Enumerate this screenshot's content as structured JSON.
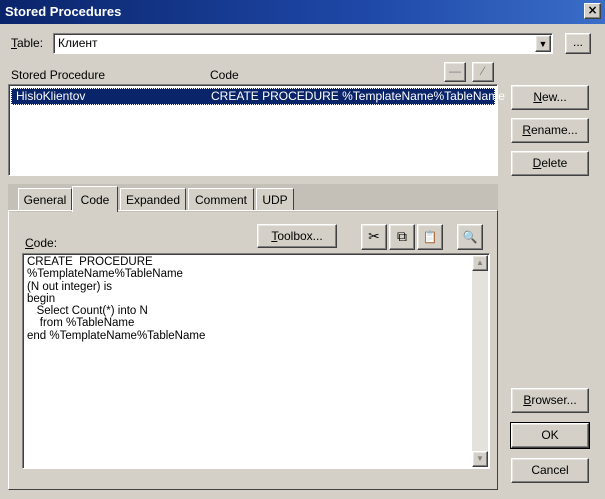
{
  "window": {
    "title": "Stored Procedures",
    "close_glyph": "×"
  },
  "table": {
    "label_hot": "T",
    "label_rest": "able:",
    "value": "Клиент",
    "browse_label": "..."
  },
  "list": {
    "header_proc": "Stored Procedure",
    "header_code": "Code",
    "rows": [
      {
        "name": "HisloKlientov",
        "code": "CREATE  PROCEDURE %TemplateName%TableName"
      }
    ],
    "icon_a": "—",
    "icon_b": "⁄"
  },
  "buttons": {
    "new_hot": "N",
    "new_rest": "ew...",
    "rename_hot": "R",
    "rename_rest": "ename...",
    "delete_hot": "D",
    "delete_rest": "elete",
    "browser_hot": "B",
    "browser_rest": "rowser...",
    "ok": "OK",
    "cancel": "Cancel"
  },
  "tabs": [
    "General",
    "Code",
    "Expanded",
    "Comment",
    "UDP"
  ],
  "code_panel": {
    "label_hot": "C",
    "label_rest": "ode:",
    "toolbox_hot": "T",
    "toolbox_rest": "oolbox...",
    "icons": {
      "cut": "✂",
      "copy": "⧉",
      "paste": "📋",
      "preview": "🔍"
    },
    "text": "CREATE  PROCEDURE\n%TemplateName%TableName\n(N out integer) is\nbegin\n   Select Count(*) into N\n    from %TableName\nend %TemplateName%TableName"
  }
}
